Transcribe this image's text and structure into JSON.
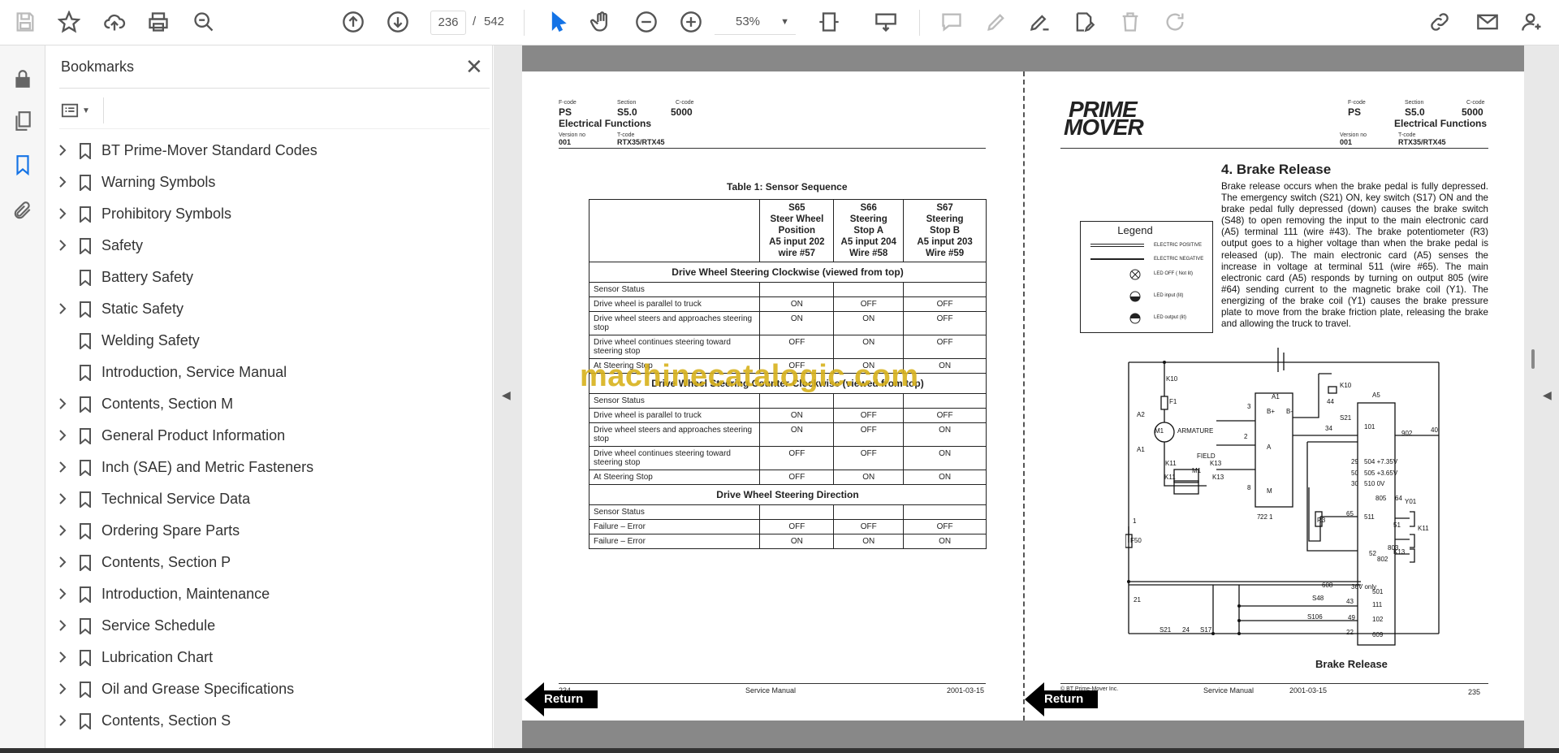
{
  "toolbar": {
    "page_current": "236",
    "page_separator": "/",
    "page_total": "542",
    "zoom": "53%"
  },
  "bookmarks": {
    "title": "Bookmarks",
    "close_glyph": "✕",
    "items": [
      {
        "label": "BT Prime-Mover Standard Codes",
        "expandable": true
      },
      {
        "label": "Warning Symbols",
        "expandable": true
      },
      {
        "label": "Prohibitory Symbols",
        "expandable": true
      },
      {
        "label": "Safety",
        "expandable": true
      },
      {
        "label": "Battery Safety",
        "expandable": false
      },
      {
        "label": "Static Safety",
        "expandable": true
      },
      {
        "label": "Welding Safety",
        "expandable": false
      },
      {
        "label": "Introduction, Service Manual",
        "expandable": false
      },
      {
        "label": "Contents, Section M",
        "expandable": true
      },
      {
        "label": "General Product Information",
        "expandable": true
      },
      {
        "label": "Inch (SAE) and Metric Fasteners",
        "expandable": true
      },
      {
        "label": "Technical Service Data",
        "expandable": true
      },
      {
        "label": "Ordering Spare Parts",
        "expandable": true
      },
      {
        "label": "Contents, Section P",
        "expandable": true
      },
      {
        "label": "Introduction, Maintenance",
        "expandable": true
      },
      {
        "label": "Service Schedule",
        "expandable": true
      },
      {
        "label": "Lubrication Chart",
        "expandable": true
      },
      {
        "label": "Oil and Grease Specifications",
        "expandable": true
      },
      {
        "label": "Contents, Section S",
        "expandable": true
      }
    ]
  },
  "left_page": {
    "hdr": {
      "fcode_lbl": "F-code",
      "fcode": "PS",
      "section_lbl": "Section",
      "section": "S5.0",
      "ccode_lbl": "C-code",
      "ccode": "5000",
      "subtitle": "Electrical Functions",
      "version_lbl": "Version no",
      "version": "001",
      "tcode_lbl": "T-code",
      "tcode": "RTX35/RTX45"
    },
    "table_title": "Table 1: Sensor Sequence",
    "columns": [
      "S65\nSteer Wheel\nPosition\nA5 input 202\nwire #57",
      "S66\nSteering\nStop A\nA5 input 204\nWire #58",
      "S67\nSteering\nStop B\nA5 input 203\nWire #59"
    ],
    "sections": [
      {
        "title": "Drive Wheel Steering Clockwise (viewed from top)",
        "rows": [
          {
            "label": "Sensor Status",
            "v": [
              "",
              "",
              ""
            ]
          },
          {
            "label": "Drive wheel is parallel to truck",
            "v": [
              "ON",
              "OFF",
              "OFF"
            ]
          },
          {
            "label": "Drive wheel steers and approaches steering stop",
            "v": [
              "ON",
              "ON",
              "OFF"
            ]
          },
          {
            "label": "Drive wheel continues steering toward steering stop",
            "v": [
              "OFF",
              "ON",
              "OFF"
            ]
          },
          {
            "label": "At Steering Stop",
            "v": [
              "OFF",
              "ON",
              "ON"
            ]
          }
        ]
      },
      {
        "title": "Drive Wheel Steering Counter-Clockwise (viewed from top)",
        "rows": [
          {
            "label": "Sensor Status",
            "v": [
              "",
              "",
              ""
            ]
          },
          {
            "label": "Drive wheel is parallel to truck",
            "v": [
              "ON",
              "OFF",
              "OFF"
            ]
          },
          {
            "label": "Drive wheel steers and approaches steering stop",
            "v": [
              "ON",
              "OFF",
              "ON"
            ]
          },
          {
            "label": "Drive wheel continues steering toward steering stop",
            "v": [
              "OFF",
              "OFF",
              "ON"
            ]
          },
          {
            "label": "At Steering Stop",
            "v": [
              "OFF",
              "ON",
              "ON"
            ]
          }
        ]
      },
      {
        "title": "Drive Wheel Steering Direction",
        "rows": [
          {
            "label": "Sensor Status",
            "v": [
              "",
              "",
              ""
            ]
          },
          {
            "label": "Failure – Error",
            "v": [
              "OFF",
              "OFF",
              "OFF"
            ]
          },
          {
            "label": "Failure – Error",
            "v": [
              "ON",
              "ON",
              "ON"
            ]
          }
        ]
      }
    ],
    "footer": {
      "page": "234",
      "center": "Service Manual",
      "date": "2001-03-15"
    },
    "return_label": "Return"
  },
  "right_page": {
    "logo_line1": "PRIME",
    "logo_line2": "MOVER",
    "hdr": {
      "fcode_lbl": "F-code",
      "fcode": "PS",
      "section_lbl": "Section",
      "section": "S5.0",
      "ccode_lbl": "C-code",
      "ccode": "5000",
      "subtitle": "Electrical Functions",
      "version_lbl": "Version no",
      "version": "001",
      "tcode_lbl": "T-code",
      "tcode": "RTX35/RTX45"
    },
    "heading": "4. Brake Release",
    "body": "Brake release occurs when the brake pedal is fully depressed. The emergency switch (S21) ON, key switch (S17) ON and the brake pedal fully depressed (down) causes the brake switch (S48) to open removing the input to the main electronic card (A5) terminal 111 (wire #43). The brake potentiometer (R3) output goes to a higher voltage than when the brake pedal is released (up). The main electronic card (A5) senses the increase in voltage at terminal 511 (wire #65). The main electronic card (A5) responds by turning on output 805 (wire #64) sending current to the magnetic brake coil (Y1). The energizing of the brake coil (Y1) causes the brake pressure plate to move from the brake friction plate, releasing the brake and allowing the truck to travel.",
    "legend": {
      "title": "Legend",
      "items": [
        "ELECTRIC POSITIVE",
        "ELECTRIC NEGATIVE",
        "LED OFF ( Not lit)",
        "LED input (lit)",
        "LED output (lit)"
      ]
    },
    "schematic_labels": [
      "K10",
      "F1",
      "A2",
      "M1",
      "ARMATURE",
      "A1",
      "FIELD",
      "K11",
      "K13",
      "M1",
      "K11",
      "K13",
      "1",
      "F50",
      "21",
      "S21",
      "24",
      "S17",
      "A1",
      "B+",
      "B-",
      "A",
      "M",
      "3",
      "2",
      "8",
      "7",
      "22",
      "1",
      "44",
      "K10",
      "S21",
      "34",
      "A5",
      "101",
      "902",
      "40",
      "29",
      "504 +7.35V",
      "50",
      "505 +3.65V",
      "30",
      "510 0V",
      "R3",
      "65",
      "511",
      "805",
      "64",
      "Y01",
      "51",
      "K11",
      "803",
      "52",
      "K13",
      "802",
      "608",
      "36V only",
      "501",
      "S48",
      "43",
      "111",
      "S106",
      "49",
      "102",
      "22",
      "609"
    ],
    "diagram_title": "Brake Release",
    "footer": {
      "left": "© BT Prime-Mover Inc.",
      "center": "Service Manual",
      "date": "2001-03-15",
      "page": "235"
    },
    "return_label": "Return"
  },
  "watermark": "machinecatalogic.com"
}
